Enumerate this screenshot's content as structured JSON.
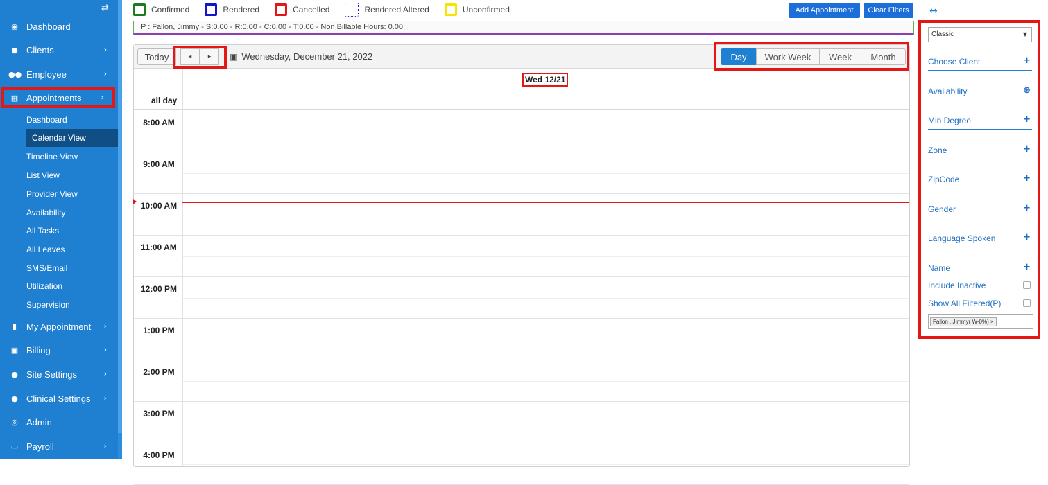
{
  "sidebar": {
    "toggle_icon": "swap-arrows-icon",
    "items": [
      {
        "label": "Dashboard",
        "icon": "dashboard-icon"
      },
      {
        "label": "Clients",
        "icon": "user-icon"
      },
      {
        "label": "Employee",
        "icon": "users-icon"
      },
      {
        "label": "Appointments",
        "icon": "calendar-icon"
      },
      {
        "label": "My Appointment",
        "icon": "building-icon"
      },
      {
        "label": "Billing",
        "icon": "money-icon"
      },
      {
        "label": "Site Settings",
        "icon": "user-icon"
      },
      {
        "label": "Clinical Settings",
        "icon": "user-icon"
      },
      {
        "label": "Admin",
        "icon": "user-circle-icon"
      },
      {
        "label": "Payroll",
        "icon": "credit-card-icon"
      }
    ],
    "sub_items": [
      "Dashboard",
      "Calendar View",
      "Timeline View",
      "List View",
      "Provider View",
      "Availability",
      "All Tasks",
      "All Leaves",
      "SMS/Email",
      "Utilization",
      "Supervision"
    ]
  },
  "legend": [
    {
      "label": "Confirmed",
      "color": "#1e7a1e",
      "style": "solid"
    },
    {
      "label": "Rendered",
      "color": "#1414c8",
      "style": "solid"
    },
    {
      "label": "Cancelled",
      "color": "#e41616",
      "style": "solid"
    },
    {
      "label": "Rendered Altered",
      "color": "#1414c8",
      "style": "dotted"
    },
    {
      "label": "Unconfirmed",
      "color": "#f5e500",
      "style": "solid"
    }
  ],
  "actions": {
    "add_appointment": "Add Appointment",
    "clear_filters": "Clear Filters"
  },
  "summary": "P : Fallon, Jimmy - S:0.00 - R:0.00 - C:0.00 - T:0.00 - Non Billable Hours: 0.00;",
  "toolbar": {
    "today": "Today",
    "prev": "◂",
    "next": "▸",
    "date": "Wednesday, December 21, 2022",
    "views": [
      "Day",
      "Work Week",
      "Week",
      "Month"
    ],
    "selected_view": "Day"
  },
  "day_header": "Wed 12/21",
  "all_day": "all day",
  "hours": [
    "8:00 AM",
    "9:00 AM",
    "10:00 AM",
    "11:00 AM",
    "12:00 PM",
    "1:00 PM",
    "2:00 PM",
    "3:00 PM",
    "4:00 PM"
  ],
  "right_panel": {
    "toggle_icon": "expand-horizontal-icon",
    "select_value": "Classic",
    "filters": [
      "Choose Client",
      "Availability",
      "Min Degree",
      "Zone",
      "ZipCode",
      "Gender",
      "Language Spoken",
      "Name"
    ],
    "checks": [
      "Include Inactive",
      "Show All Filtered(P)"
    ],
    "tag": "Fallon , Jimmy( W-0%)",
    "tag_remove": "×"
  },
  "colors": {
    "sidebar": "#1f7fd0",
    "accent_red": "#e41616",
    "button_blue": "#1c6fd8"
  }
}
